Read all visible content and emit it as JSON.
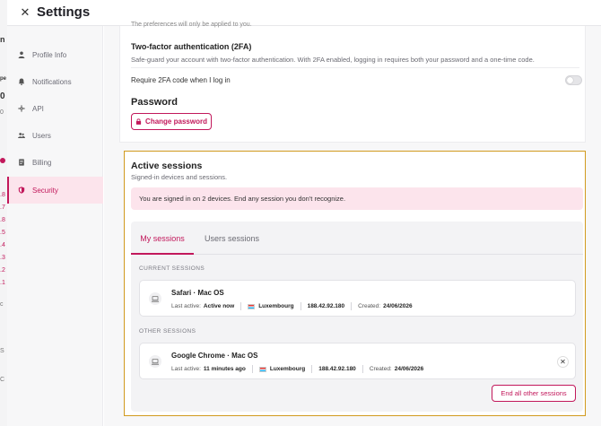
{
  "header": {
    "title": "Settings"
  },
  "sidebar": {
    "items": [
      {
        "label": "Profile Info",
        "icon": "user-icon"
      },
      {
        "label": "Notifications",
        "icon": "bell-icon"
      },
      {
        "label": "API",
        "icon": "api-icon"
      },
      {
        "label": "Users",
        "icon": "users-icon"
      },
      {
        "label": "Billing",
        "icon": "billing-icon"
      },
      {
        "label": "Security",
        "icon": "shield-icon",
        "active": true
      }
    ]
  },
  "security": {
    "truncated_text": "The preferences will only be applied to you.",
    "two_factor": {
      "title": "Two-factor authentication (2FA)",
      "description": "Safe-guard your account with two-factor authentication. With 2FA enabled, logging in requires both your password and a one-time code.",
      "toggle_label": "Require 2FA code when I log in",
      "enabled": false
    },
    "password": {
      "title": "Password",
      "button_label": "Change password"
    }
  },
  "sessions": {
    "title": "Active sessions",
    "subtitle": "Signed-in devices and sessions.",
    "alert": "You are signed in on 2 devices. End any session you don't recognize.",
    "tabs": [
      {
        "label": "My sessions",
        "active": true
      },
      {
        "label": "Users sessions",
        "active": false
      }
    ],
    "current_label": "CURRENT SESSIONS",
    "other_label": "OTHER SESSIONS",
    "last_active_label": "Last active:",
    "created_label": "Created:",
    "current": {
      "device": "Safari · Mac OS",
      "last_active": "Active now",
      "country": "Luxembourg",
      "ip": "188.42.92.180",
      "created": "24/06/2026"
    },
    "other": [
      {
        "device": "Google Chrome · Mac OS",
        "last_active": "11 minutes ago",
        "country": "Luxembourg",
        "ip": "188.42.92.180",
        "created": "24/06/2026"
      }
    ],
    "end_all_label": "End all other sessions"
  },
  "colors": {
    "accent": "#c2185b",
    "alert_bg": "#fce4ec",
    "highlight_border": "#d19a1f"
  }
}
